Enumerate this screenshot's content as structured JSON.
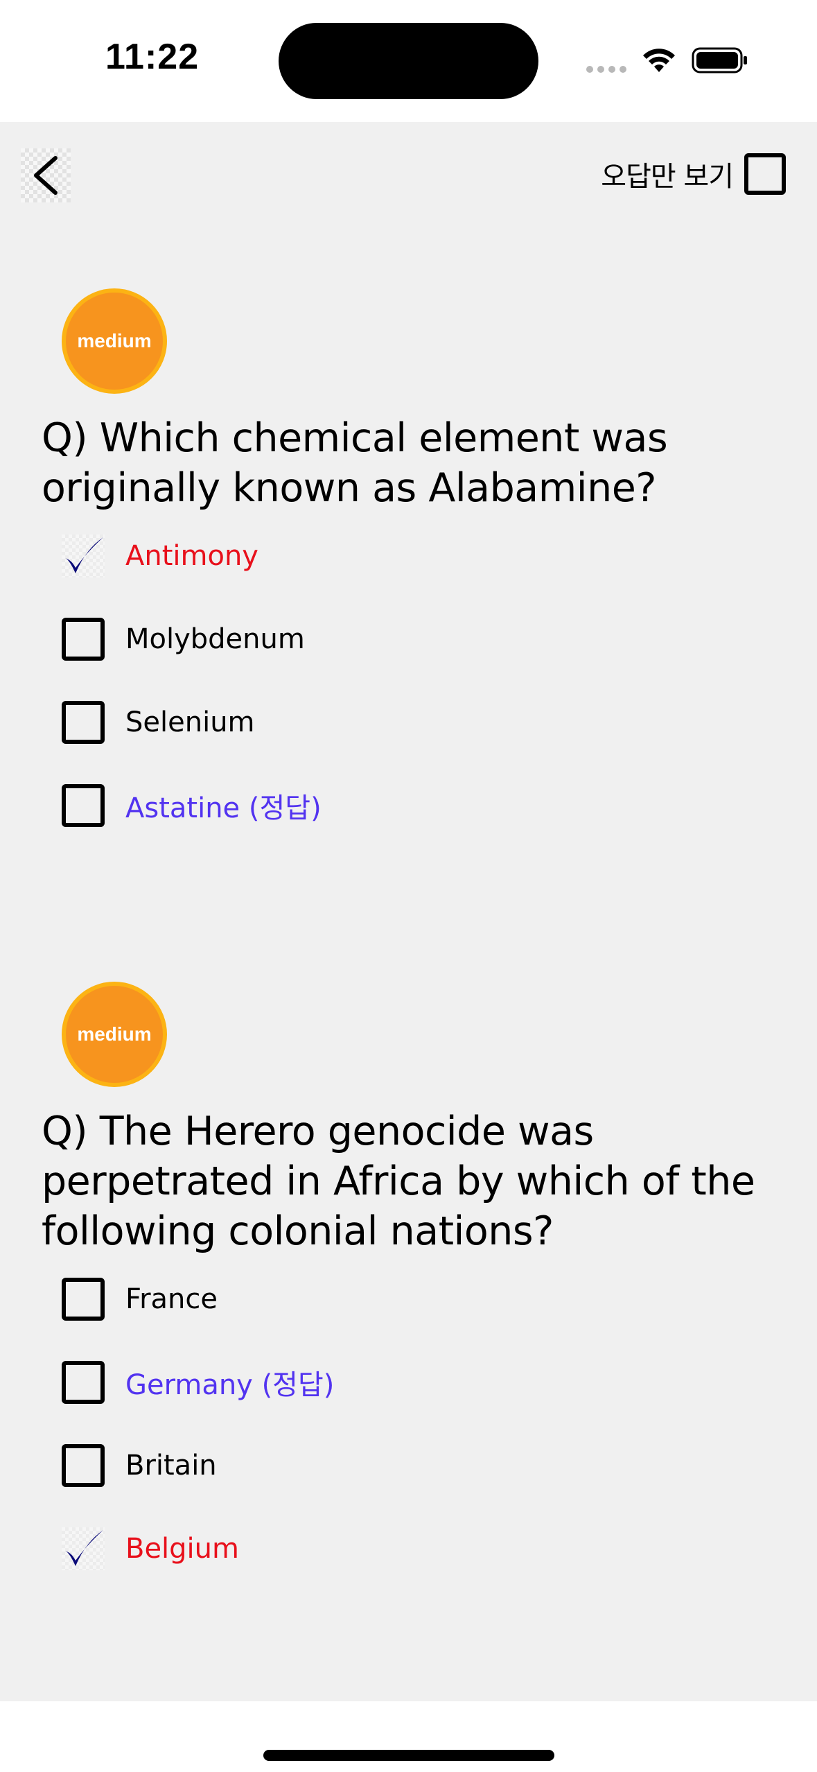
{
  "status_bar": {
    "time": "11:22",
    "icons": [
      "cellular-signal-icon",
      "wifi-icon",
      "battery-icon"
    ]
  },
  "header": {
    "back_icon": "chevron-left-icon",
    "filter_label": "오답만 보기",
    "filter_checked": false
  },
  "questions": [
    {
      "difficulty": "medium",
      "text": "Q) Which chemical element was originally known as Alabamine?",
      "options": [
        {
          "label": "Antimony",
          "state": "selected-wrong"
        },
        {
          "label": "Molybdenum",
          "state": "unselected"
        },
        {
          "label": "Selenium",
          "state": "unselected"
        },
        {
          "label": "Astatine (정답)",
          "state": "correct"
        }
      ]
    },
    {
      "difficulty": "medium",
      "text": "Q) The Herero genocide was perpetrated in Africa by which of the following colonial nations?",
      "options": [
        {
          "label": "France",
          "state": "unselected"
        },
        {
          "label": "Germany (정답)",
          "state": "correct"
        },
        {
          "label": "Britain",
          "state": "unselected"
        },
        {
          "label": "Belgium",
          "state": "selected-wrong"
        }
      ]
    }
  ],
  "colors": {
    "background": "#f0f0f0",
    "badge": "#f7941e",
    "badge_border": "#fcb314",
    "wrong": "#e8101b",
    "correct": "#5233f0",
    "checkmark": "#0a0a78"
  }
}
